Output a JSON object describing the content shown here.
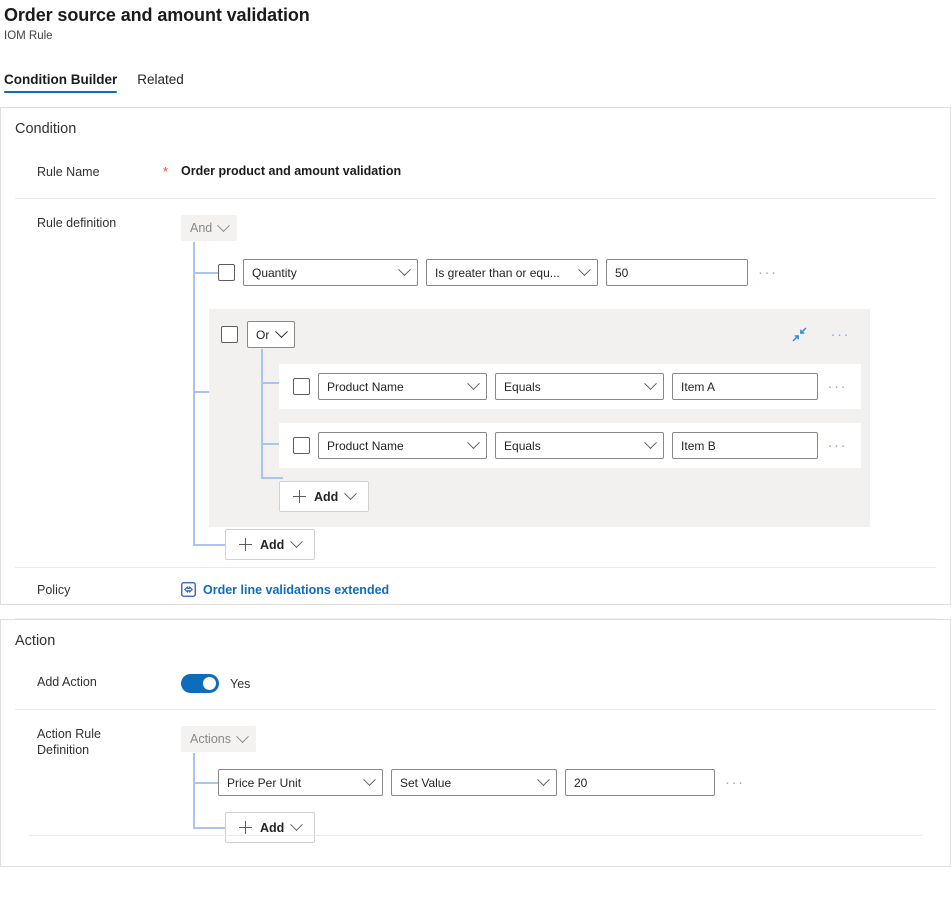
{
  "header": {
    "title": "Order source and amount validation",
    "subtitle": "IOM Rule"
  },
  "tabs": [
    {
      "label": "Condition Builder",
      "active": true
    },
    {
      "label": "Related",
      "active": false
    }
  ],
  "condition_card": {
    "title": "Condition",
    "rule_name": {
      "label": "Rule Name",
      "required_marker": "*",
      "value": "Order product and amount validation"
    },
    "rule_definition": {
      "label": "Rule definition",
      "root_operator": "And",
      "rows": [
        {
          "field": "Quantity",
          "operator": "Is greater than or equ...",
          "value": "50",
          "more": "···"
        }
      ],
      "group": {
        "operator": "Or",
        "collapse_label": "Collapse",
        "more": "···",
        "rows": [
          {
            "field": "Product Name",
            "operator": "Equals",
            "value": "Item A",
            "more": "···"
          },
          {
            "field": "Product Name",
            "operator": "Equals",
            "value": "Item B",
            "more": "···"
          }
        ],
        "add_label": "Add"
      },
      "add_label": "Add"
    },
    "policy": {
      "label": "Policy",
      "link_text": "Order line validations extended"
    }
  },
  "action_card": {
    "title": "Action",
    "add_action": {
      "label": "Add Action",
      "toggle_state": "Yes"
    },
    "action_rule_definition": {
      "label_line1": "Action Rule",
      "label_line2": "Definition",
      "root_operator": "Actions",
      "rows": [
        {
          "field": "Price Per Unit",
          "operator": "Set Value",
          "value": "20",
          "more": "···"
        }
      ],
      "add_label": "Add"
    }
  },
  "colors": {
    "accent": "#0f6cbd",
    "tree_line": "#a9c4f0",
    "group_bg": "#f2f1f0",
    "required": "#e74c3c"
  }
}
